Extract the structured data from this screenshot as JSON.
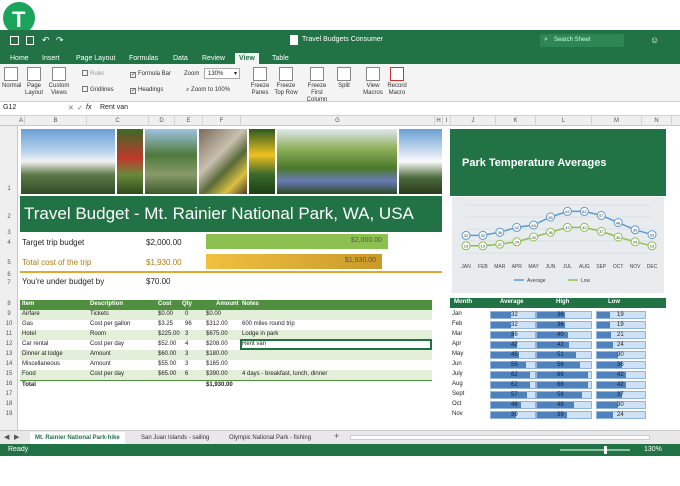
{
  "app": {
    "title": "Travel Budgets Consumer",
    "search_placeholder": "Search Sheet"
  },
  "ribbon": {
    "tabs": [
      "Home",
      "Insert",
      "Page Layout",
      "Formulas",
      "Data",
      "Review",
      "View",
      "Table"
    ],
    "active_tab": "View",
    "buttons": {
      "normal": "Normal",
      "page_layout": "Page Layout",
      "custom_views": "Custom Views",
      "ruler": "Ruler",
      "formula_bar": "Formula Bar",
      "gridlines": "Gridlines",
      "headings": "Headings",
      "zoom_label": "Zoom",
      "zoom_value": "130%",
      "zoom_100": "Zoom to 100%",
      "freeze_panes": "Freeze Panes",
      "freeze_top_row": "Freeze Top Row",
      "freeze_first_column": "Freeze First Column",
      "split": "Split",
      "view_macros": "View Macros",
      "record_macro": "Record Macro"
    }
  },
  "formula_bar": {
    "cell_ref": "G12",
    "fx": "fx",
    "value": "Rent van"
  },
  "columns": [
    "A",
    "B",
    "C",
    "D",
    "E",
    "F",
    "G",
    "H",
    "I",
    "J",
    "K",
    "L",
    "M",
    "N"
  ],
  "rows": [
    "1",
    "2",
    "3",
    "4",
    "5",
    "6",
    "7",
    "8",
    "9",
    "10",
    "11",
    "12",
    "13",
    "14",
    "15",
    "16",
    "17",
    "18",
    "19"
  ],
  "sheet": {
    "title": "Travel Budget - Mt. Rainier National Park, WA, USA",
    "target_label": "Target trip budget",
    "target_value": "$2,000.00",
    "target_bar": "$2,000.00",
    "total_label": "Total cost of the trip",
    "total_value": "$1,930.00",
    "total_bar": "$1,930.00",
    "under_label": "You're under budget by",
    "under_value": "$70.00",
    "table_headers": [
      "Item",
      "Description",
      "Cost",
      "Qty",
      "Amount",
      "Notes"
    ],
    "table_rows": [
      [
        "Airfare",
        "Tickets",
        "$0.00",
        "0",
        "$0.00",
        ""
      ],
      [
        "Gas",
        "Cost per gallon",
        "$3.25",
        "96",
        "$312.00",
        "600 miles round trip"
      ],
      [
        "Hotel",
        "Room",
        "$225.00",
        "3",
        "$675.00",
        "Lodge in park"
      ],
      [
        "Car rental",
        "Cost per day",
        "$52.00",
        "4",
        "$208.00",
        "Rent van"
      ],
      [
        "Dinner at lodge",
        "Amount",
        "$60.00",
        "3",
        "$180.00",
        ""
      ],
      [
        "Miscellaneous",
        "Amount",
        "$55.00",
        "3",
        "$165.00",
        ""
      ],
      [
        "Food",
        "Cost per day",
        "$65.00",
        "6",
        "$390.00",
        "4 days - breakfast, lunch, dinner"
      ]
    ],
    "total_row_label": "Total",
    "total_row_amount": "$1,930.00"
  },
  "chart_data": {
    "type": "line",
    "title": "Park Temperature Averages",
    "categories": [
      "JAN",
      "FEB",
      "MAR",
      "APR",
      "MAY",
      "JUN",
      "JUL",
      "AUG",
      "SEP",
      "OCT",
      "NOV",
      "DEC"
    ],
    "series": [
      {
        "name": "Average",
        "values": [
          32,
          32,
          36,
          42,
          45,
          55,
          62,
          62,
          57,
          48,
          39,
          33
        ],
        "color": "#5b9bd5"
      },
      {
        "name": "Low",
        "values": [
          19,
          19,
          21,
          24,
          30,
          36,
          42,
          42,
          37,
          30,
          24,
          19
        ],
        "color": "#8cc152"
      }
    ],
    "grid": true,
    "legend": "bottom"
  },
  "month_table": {
    "headers": [
      "Month",
      "Average",
      "High",
      "Low"
    ],
    "rows": [
      [
        "Jan",
        32,
        36,
        19
      ],
      [
        "Feb",
        32,
        36,
        19
      ],
      [
        "Mar",
        36,
        40,
        21
      ],
      [
        "Apr",
        42,
        42,
        24
      ],
      [
        "May",
        45,
        51,
        30
      ],
      [
        "Jun",
        55,
        56,
        36
      ],
      [
        "July",
        62,
        66,
        42
      ],
      [
        "Aug",
        62,
        66,
        42
      ],
      [
        "Sept",
        57,
        58,
        37
      ],
      [
        "Oct",
        48,
        48,
        30
      ],
      [
        "Nov",
        39,
        39,
        24
      ]
    ],
    "max": 70
  },
  "sheet_tabs": [
    "Mt. Rainier National Park-hike",
    "San Juan Islands - sailing",
    "Olympic National Park - fishing"
  ],
  "status": {
    "ready": "Ready",
    "zoom": "130%"
  },
  "colors": {
    "excel_green": "#217346",
    "table_green": "#4f8f3f",
    "accent_orange": "#e2a72e"
  }
}
